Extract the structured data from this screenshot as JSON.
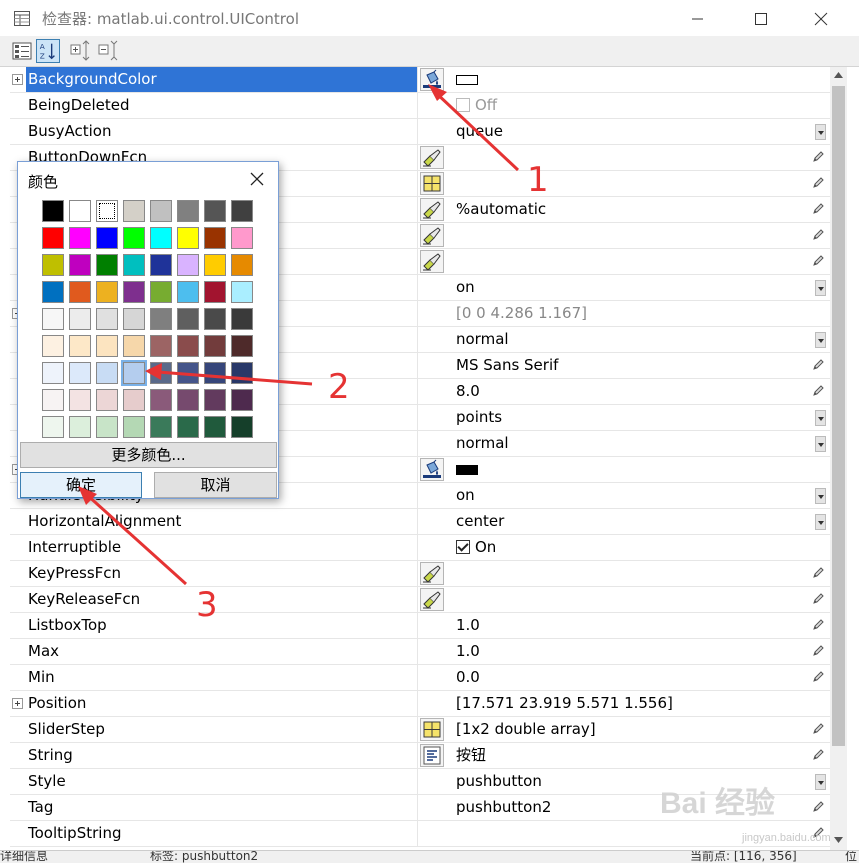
{
  "window": {
    "title": "检查器: matlab.ui.control.UIControl"
  },
  "toolbar": {
    "buttons": [
      "categorize-icon",
      "sort-alpha-icon",
      "expand-all-icon",
      "collapse-all-icon"
    ]
  },
  "properties": [
    {
      "name": "BackgroundColor",
      "value": "",
      "kind": "color-white",
      "expandable": true,
      "selected": true,
      "button": "paint-bucket"
    },
    {
      "name": "BeingDeleted",
      "value": "Off",
      "kind": "checkbox-disabled"
    },
    {
      "name": "BusyAction",
      "value": "queue",
      "kind": "dropdown"
    },
    {
      "name": "ButtonDownFcn",
      "value": "",
      "kind": "pencil",
      "button": "callback"
    },
    {
      "name": "",
      "value": "",
      "kind": "pencil",
      "button": "array"
    },
    {
      "name": "",
      "value": "%automatic",
      "kind": "pencil",
      "button": "callback"
    },
    {
      "name": "",
      "value": "",
      "kind": "pencil",
      "button": "callback"
    },
    {
      "name": "",
      "value": "",
      "kind": "pencil",
      "button": "callback"
    },
    {
      "name": "",
      "value": "on",
      "kind": "dropdown"
    },
    {
      "name": "",
      "value": "[0 0 4.286 1.167]",
      "kind": "gray",
      "expandable": true
    },
    {
      "name": "",
      "value": "normal",
      "kind": "dropdown"
    },
    {
      "name": "",
      "value": "MS Sans Serif",
      "kind": "pencil"
    },
    {
      "name": "",
      "value": "8.0",
      "kind": "pencil"
    },
    {
      "name": "",
      "value": "points",
      "kind": "dropdown"
    },
    {
      "name": "",
      "value": "normal",
      "kind": "dropdown"
    },
    {
      "name": "",
      "value": "",
      "kind": "color-black",
      "expandable": true,
      "button": "paint-bucket"
    },
    {
      "name": "HandleVisibility",
      "value": "on",
      "kind": "dropdown"
    },
    {
      "name": "HorizontalAlignment",
      "value": "center",
      "kind": "dropdown"
    },
    {
      "name": "Interruptible",
      "value": "On",
      "kind": "checkbox-on"
    },
    {
      "name": "KeyPressFcn",
      "value": "",
      "kind": "pencil",
      "button": "callback"
    },
    {
      "name": "KeyReleaseFcn",
      "value": "",
      "kind": "pencil",
      "button": "callback"
    },
    {
      "name": "ListboxTop",
      "value": "1.0",
      "kind": "pencil"
    },
    {
      "name": "Max",
      "value": "1.0",
      "kind": "pencil"
    },
    {
      "name": "Min",
      "value": "0.0",
      "kind": "pencil"
    },
    {
      "name": "Position",
      "value": "[17.571 23.919 5.571 1.556]",
      "kind": "text",
      "expandable": true
    },
    {
      "name": "SliderStep",
      "value": "[1x2  double array]",
      "kind": "pencil",
      "button": "array"
    },
    {
      "name": "String",
      "value": "按钮",
      "kind": "pencil",
      "button": "text"
    },
    {
      "name": "Style",
      "value": "pushbutton",
      "kind": "dropdown"
    },
    {
      "name": "Tag",
      "value": "pushbutton2",
      "kind": "pencil"
    },
    {
      "name": "TooltipString",
      "value": "",
      "kind": "pencil"
    }
  ],
  "dialog": {
    "title": "颜色",
    "more_colors": "更多颜色...",
    "ok": "确定",
    "cancel": "取消",
    "palette": [
      [
        "#000000",
        "#ffffff",
        "#ffffff",
        "#d4d0c8",
        "#c0c0c0",
        "#808080",
        "#555555",
        "#404040"
      ],
      [
        "#ff0000",
        "#ff00ff",
        "#0000ff",
        "#00ff00",
        "#00ffff",
        "#ffff00",
        "#993300",
        "#ff99cc"
      ],
      [
        "#bfbf00",
        "#bf00bf",
        "#007f00",
        "#00bfbf",
        "#1f3399",
        "#d9b3ff",
        "#ffcc00",
        "#e68a00"
      ],
      [
        "#0070c0",
        "#e05a1e",
        "#edb120",
        "#7e2f8e",
        "#77ac30",
        "#4dbeee",
        "#a2142f",
        "#aaeeff"
      ],
      [
        "#f7f7f7",
        "#ececec",
        "#e0e0e0",
        "#d6d6d6",
        "#7f7f7f",
        "#5f5f5f",
        "#4a4a4a",
        "#3a3a3a"
      ],
      [
        "#fdf1e2",
        "#fde8c8",
        "#fce4c0",
        "#f6d7aa",
        "#9c6464",
        "#8a4c4c",
        "#723c3c",
        "#4e2a2a"
      ],
      [
        "#eef3fb",
        "#dce9fa",
        "#c8dcf4",
        "#b4cdee",
        "#5a6a8a",
        "#45558a",
        "#36467a",
        "#283868"
      ],
      [
        "#f7f3f3",
        "#f3e3e3",
        "#ecd6d6",
        "#e6cccc",
        "#8a5a7a",
        "#764a6e",
        "#623a5e",
        "#4e2a4e"
      ],
      [
        "#eef6ee",
        "#dcefdc",
        "#c8e4c8",
        "#b4d8b4",
        "#3a7a5a",
        "#2a6a4a",
        "#205a3c",
        "#153f2a"
      ]
    ]
  },
  "annotations": {
    "label1": "1",
    "label2": "2",
    "label3": "3"
  },
  "statusbar": {
    "left": "详细信息",
    "tag": "标签: pushbutton2",
    "point": "当前点: [116, 356]",
    "right": "位"
  },
  "watermark": {
    "main": "Bai 经验",
    "sub": "jingyan.baidu.com"
  }
}
